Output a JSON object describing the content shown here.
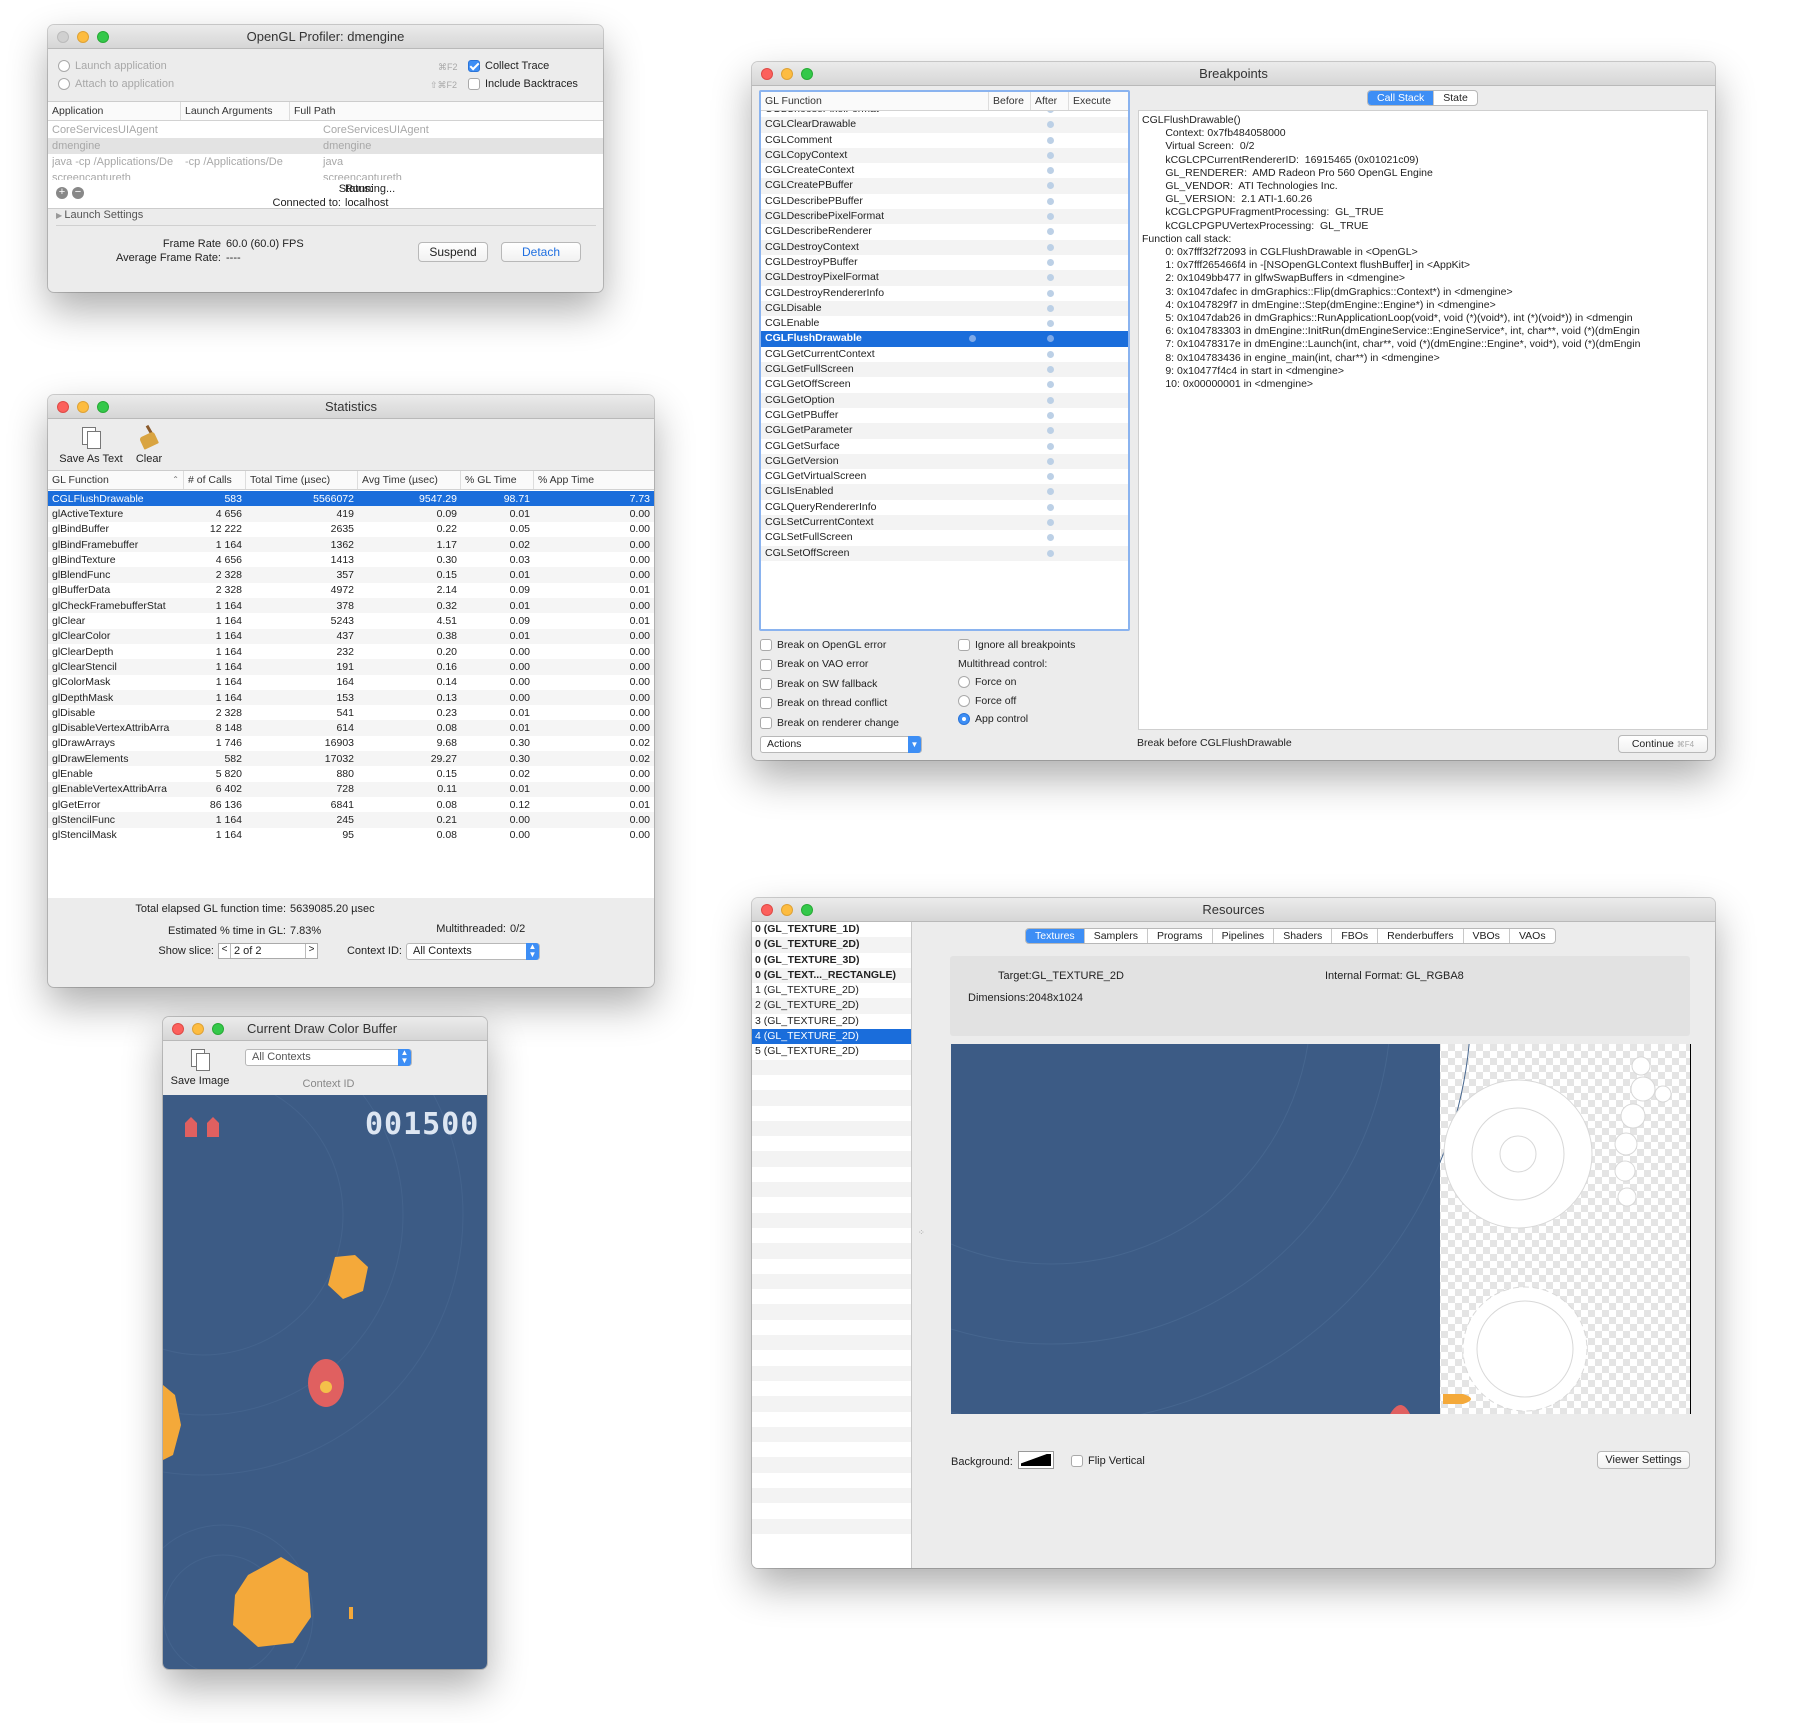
{
  "profiler": {
    "title": "OpenGL Profiler: dmengine",
    "launch_application": "Launch application",
    "attach_to_application": "Attach to application",
    "shortcut_collect": "⌘F2",
    "shortcut_backtraces": "⇧⌘F2",
    "collect_trace": "Collect Trace",
    "include_backtraces": "Include Backtraces",
    "columns": [
      "Application",
      "Launch Arguments",
      "Full Path"
    ],
    "rows": [
      [
        "CoreServicesUIAgent",
        "",
        "CoreServicesUIAgent"
      ],
      [
        "dmengine",
        "",
        "dmengine"
      ],
      [
        "java -cp /Applications/De",
        "-cp /Applications/De",
        "java"
      ],
      [
        "screencaptureth",
        "",
        "screencaptureth"
      ]
    ],
    "status_label": "Status:",
    "status_value": "Running...",
    "connected_label": "Connected to:",
    "connected_value": "localhost",
    "launch_settings": "Launch Settings",
    "frame_rate_label": "Frame Rate",
    "frame_rate_value": "60.0 (60.0) FPS",
    "avg_frame_label": "Average Frame Rate:",
    "avg_frame_value": "----",
    "suspend": "Suspend",
    "detach": "Detach"
  },
  "statistics": {
    "title": "Statistics",
    "save_as_text": "Save As Text",
    "clear": "Clear",
    "columns": [
      "GL Function",
      "# of Calls",
      "Total Time (µsec)",
      "Avg Time (µsec)",
      "% GL Time",
      "% App Time"
    ],
    "rows": [
      [
        "CGLFlushDrawable",
        "583",
        "5566072",
        "9547.29",
        "98.71",
        "7.73"
      ],
      [
        "glActiveTexture",
        "4 656",
        "419",
        "0.09",
        "0.01",
        "0.00"
      ],
      [
        "glBindBuffer",
        "12 222",
        "2635",
        "0.22",
        "0.05",
        "0.00"
      ],
      [
        "glBindFramebuffer",
        "1 164",
        "1362",
        "1.17",
        "0.02",
        "0.00"
      ],
      [
        "glBindTexture",
        "4 656",
        "1413",
        "0.30",
        "0.03",
        "0.00"
      ],
      [
        "glBlendFunc",
        "2 328",
        "357",
        "0.15",
        "0.01",
        "0.00"
      ],
      [
        "glBufferData",
        "2 328",
        "4972",
        "2.14",
        "0.09",
        "0.01"
      ],
      [
        "glCheckFramebufferStat",
        "1 164",
        "378",
        "0.32",
        "0.01",
        "0.00"
      ],
      [
        "glClear",
        "1 164",
        "5243",
        "4.51",
        "0.09",
        "0.01"
      ],
      [
        "glClearColor",
        "1 164",
        "437",
        "0.38",
        "0.01",
        "0.00"
      ],
      [
        "glClearDepth",
        "1 164",
        "232",
        "0.20",
        "0.00",
        "0.00"
      ],
      [
        "glClearStencil",
        "1 164",
        "191",
        "0.16",
        "0.00",
        "0.00"
      ],
      [
        "glColorMask",
        "1 164",
        "164",
        "0.14",
        "0.00",
        "0.00"
      ],
      [
        "glDepthMask",
        "1 164",
        "153",
        "0.13",
        "0.00",
        "0.00"
      ],
      [
        "glDisable",
        "2 328",
        "541",
        "0.23",
        "0.01",
        "0.00"
      ],
      [
        "glDisableVertexAttribArra",
        "8 148",
        "614",
        "0.08",
        "0.01",
        "0.00"
      ],
      [
        "glDrawArrays",
        "1 746",
        "16903",
        "9.68",
        "0.30",
        "0.02"
      ],
      [
        "glDrawElements",
        "582",
        "17032",
        "29.27",
        "0.30",
        "0.02"
      ],
      [
        "glEnable",
        "5 820",
        "880",
        "0.15",
        "0.02",
        "0.00"
      ],
      [
        "glEnableVertexAttribArra",
        "6 402",
        "728",
        "0.11",
        "0.01",
        "0.00"
      ],
      [
        "glGetError",
        "86 136",
        "6841",
        "0.08",
        "0.12",
        "0.01"
      ],
      [
        "glStencilFunc",
        "1 164",
        "245",
        "0.21",
        "0.00",
        "0.00"
      ],
      [
        "glStencilMask",
        "1 164",
        "95",
        "0.08",
        "0.00",
        "0.00"
      ]
    ],
    "total_elapsed_label": "Total elapsed GL function time:",
    "total_elapsed_value": "5639085.20 µsec",
    "estimated_label": "Estimated % time in GL:",
    "estimated_value": "7.83%",
    "multithreaded_label": "Multithreaded:",
    "multithreaded_value": "0/2",
    "show_slice_label": "Show slice:",
    "show_slice_value": "2 of 2",
    "context_id_label": "Context ID:",
    "context_id_value": "All Contexts"
  },
  "colorbuffer": {
    "title": "Current Draw Color Buffer",
    "save_image": "Save Image",
    "context_value": "All Contexts",
    "context_label": "Context ID",
    "score": "001500"
  },
  "breakpoints": {
    "title": "Breakpoints",
    "columns": [
      "GL Function",
      "Before",
      "After",
      "Execute"
    ],
    "functions": [
      "CGLChoosePixelFormat",
      "CGLClearDrawable",
      "CGLComment",
      "CGLCopyContext",
      "CGLCreateContext",
      "CGLCreatePBuffer",
      "CGLDescribePBuffer",
      "CGLDescribePixelFormat",
      "CGLDescribeRenderer",
      "CGLDestroyContext",
      "CGLDestroyPBuffer",
      "CGLDestroyPixelFormat",
      "CGLDestroyRendererInfo",
      "CGLDisable",
      "CGLEnable",
      "CGLFlushDrawable",
      "CGLGetCurrentContext",
      "CGLGetFullScreen",
      "CGLGetOffScreen",
      "CGLGetOption",
      "CGLGetPBuffer",
      "CGLGetParameter",
      "CGLGetSurface",
      "CGLGetVersion",
      "CGLGetVirtualScreen",
      "CGLIsEnabled",
      "CGLQueryRendererInfo",
      "CGLSetCurrentContext",
      "CGLSetFullScreen",
      "CGLSetOffScreen"
    ],
    "tabs": [
      "Call Stack",
      "State"
    ],
    "callstack": [
      "CGLFlushDrawable()",
      "        Context: 0x7fb484058000",
      "        Virtual Screen:  0/2",
      "        kCGLCPCurrentRendererID:  16915465 (0x01021c09)",
      "        GL_RENDERER:  AMD Radeon Pro 560 OpenGL Engine",
      "        GL_VENDOR:  ATI Technologies Inc.",
      "        GL_VERSION:  2.1 ATI-1.60.26",
      "        kCGLCPGPUFragmentProcessing:  GL_TRUE",
      "        kCGLCPGPUVertexProcessing:  GL_TRUE",
      "Function call stack:",
      "        0: 0x7fff32f72093 in CGLFlushDrawable in <OpenGL>",
      "        1: 0x7fff265466f4 in -[NSOpenGLContext flushBuffer] in <AppKit>",
      "        2: 0x1049bb477 in glfwSwapBuffers in <dmengine>",
      "        3: 0x1047dafec in dmGraphics::Flip(dmGraphics::Context*) in <dmengine>",
      "        4: 0x1047829f7 in dmEngine::Step(dmEngine::Engine*) in <dmengine>",
      "        5: 0x1047dab26 in dmGraphics::RunApplicationLoop(void*, void (*)(void*), int (*)(void*)) in <dmengin",
      "        6: 0x104783303 in dmEngine::InitRun(dmEngineService::EngineService*, int, char**, void (*)(dmEngin",
      "        7: 0x10478317e in dmEngine::Launch(int, char**, void (*)(dmEngine::Engine*, void*), void (*)(dmEngin",
      "        8: 0x104783436 in engine_main(int, char**) in <dmengine>",
      "        9: 0x10477f4c4 in start in <dmengine>",
      "        10: 0x00000001 in <dmengine>"
    ],
    "opt_opengl_error": "Break on OpenGL error",
    "opt_vao_error": "Break on VAO error",
    "opt_sw_fallback": "Break on SW fallback",
    "opt_thread_conflict": "Break on thread conflict",
    "opt_renderer_change": "Break on renderer change",
    "ignore_all": "Ignore all breakpoints",
    "multithread_control": "Multithread control:",
    "force_on": "Force on",
    "force_off": "Force off",
    "app_control": "App control",
    "actions": "Actions",
    "break_status": "Break before CGLFlushDrawable",
    "continue": "Continue",
    "continue_shortcut": "⌘F4"
  },
  "resources": {
    "title": "Resources",
    "items": [
      "0 (GL_TEXTURE_1D)",
      "0 (GL_TEXTURE_2D)",
      "0 (GL_TEXTURE_3D)",
      "0 (GL_TEXT..._RECTANGLE)",
      "1 (GL_TEXTURE_2D)",
      "2 (GL_TEXTURE_2D)",
      "3 (GL_TEXTURE_2D)",
      "4 (GL_TEXTURE_2D)",
      "5 (GL_TEXTURE_2D)"
    ],
    "tabs": [
      "Textures",
      "Samplers",
      "Programs",
      "Pipelines",
      "Shaders",
      "FBOs",
      "Renderbuffers",
      "VBOs",
      "VAOs"
    ],
    "target_label": "Target:",
    "target_value": "GL_TEXTURE_2D",
    "internal_format_label": "Internal Format:",
    "internal_format_value": "GL_RGBA8",
    "dimensions_label": "Dimensions:",
    "dimensions_value": "2048x1024",
    "background_label": "Background:",
    "flip_vertical": "Flip Vertical",
    "viewer_settings": "Viewer Settings"
  }
}
